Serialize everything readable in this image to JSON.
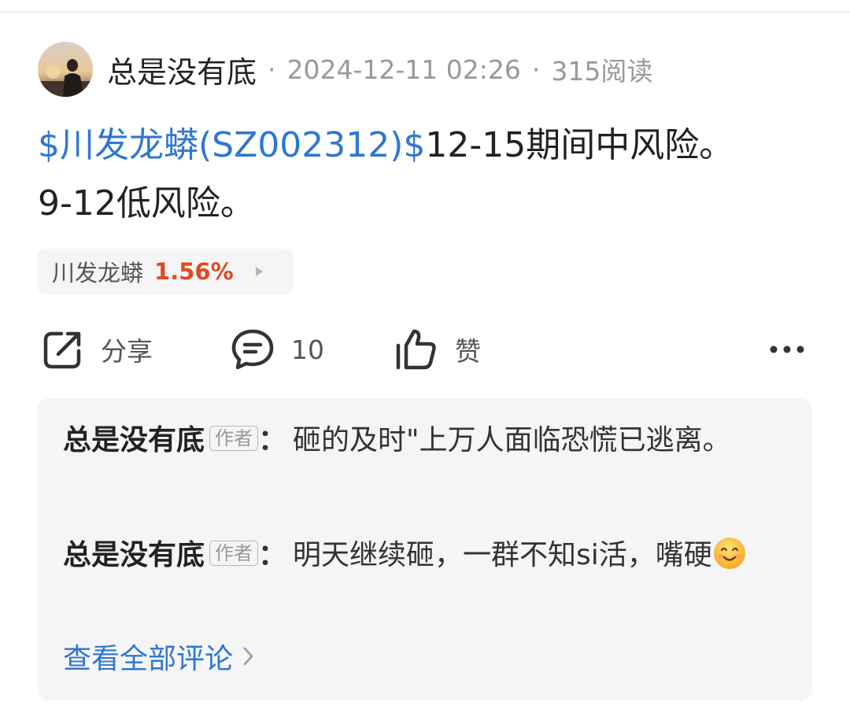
{
  "post": {
    "author": "总是没有底",
    "timestamp": "2024-12-11 02:26",
    "read_count": "315阅读",
    "separator": "·",
    "stock_tag": "$川发龙蟒(SZ002312)$",
    "body_line1_rest": "12-15期间中风险。",
    "body_line2": "9-12低风险。"
  },
  "stock_chip": {
    "name": "川发龙蟒",
    "change": "1.56%"
  },
  "actions": {
    "share_label": "分享",
    "comment_count": "10",
    "like_label": "赞",
    "icons": [
      "share-icon",
      "comment-icon",
      "like-icon",
      "more-icon"
    ]
  },
  "comments": [
    {
      "author": "总是没有底",
      "badge": "作者",
      "colon": "：",
      "text": "砸的及时\"上万人面临恐慌已逃离。"
    },
    {
      "author": "总是没有底",
      "badge": "作者",
      "colon": "：",
      "text": "明天继续砸，一群不知si活，嘴硬"
    }
  ],
  "view_all_label": "查看全部评论",
  "colors": {
    "link": "#2f77d1",
    "up": "#e14a22",
    "muted": "#999999",
    "panel": "#f5f5f7"
  }
}
